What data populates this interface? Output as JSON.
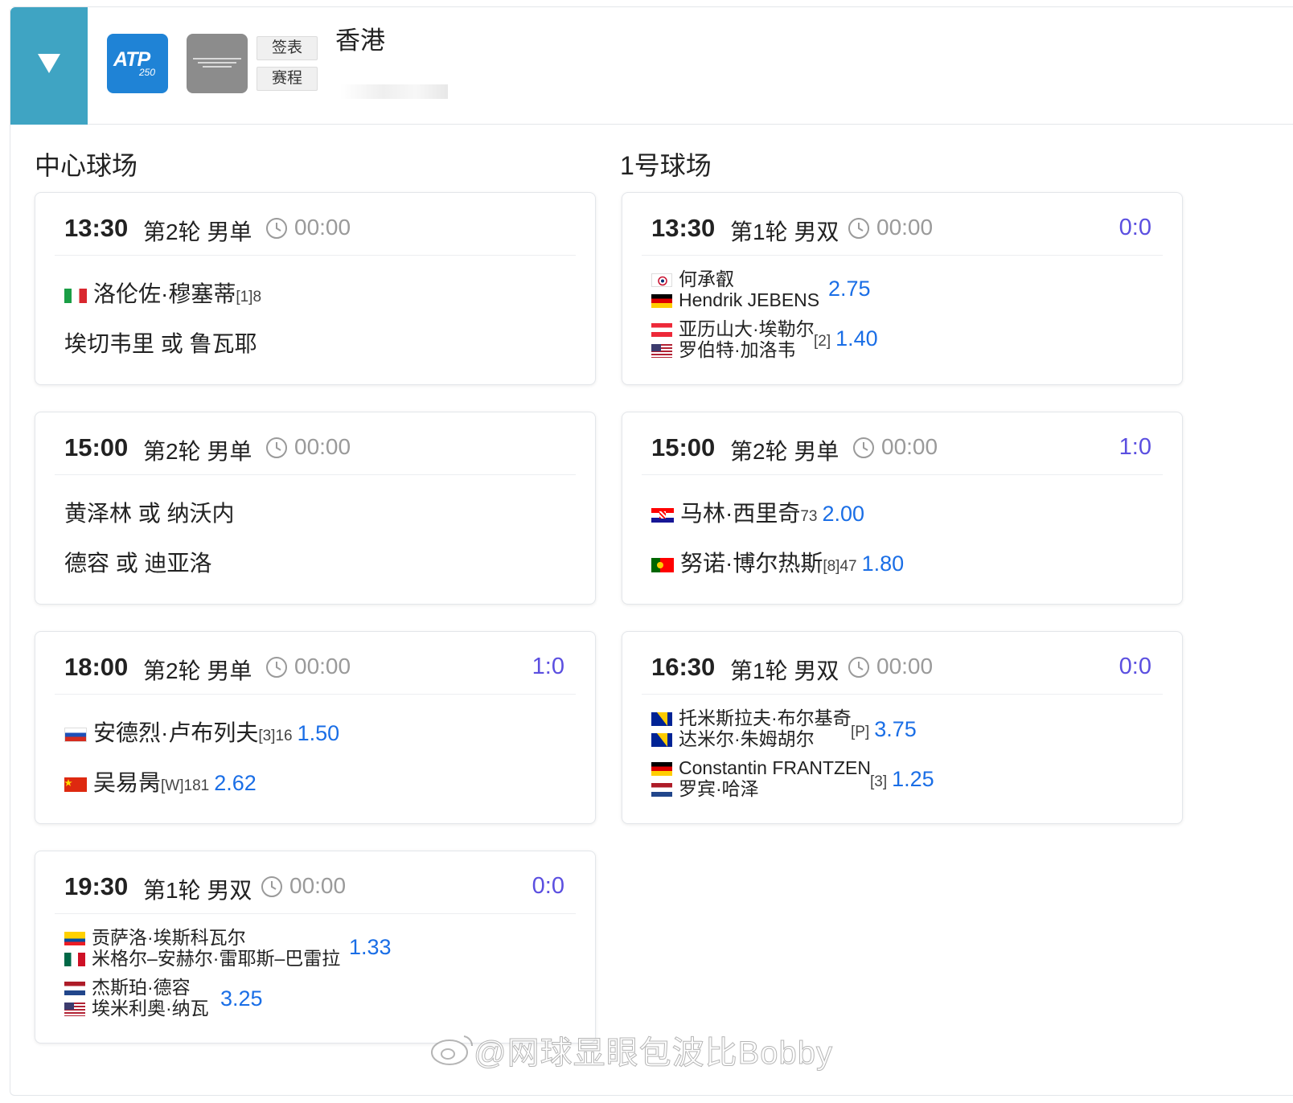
{
  "header": {
    "toggle_icon": "triangle-down-icon",
    "atp_logo_text": "ATP",
    "atp_logo_num": "250",
    "tab_draw": "签表",
    "tab_schedule": "赛程",
    "city": "香港"
  },
  "colors": {
    "toggle_bg": "#3fa4c3",
    "atp_blue": "#1f83d6",
    "odds_blue": "#1a6ee6",
    "score_purple": "#5b4fe0"
  },
  "courts": [
    {
      "name": "中心球场",
      "matches": [
        {
          "time": "13:30",
          "round": "第2轮 男单",
          "elapsed": "00:00",
          "score": "",
          "row1": {
            "name": "洛伦佐·穆塞蒂",
            "seed": "[1]8",
            "odds": ""
          },
          "row2": {
            "name": "埃切韦里  或  鲁瓦耶"
          }
        },
        {
          "time": "15:00",
          "round": "第2轮 男单",
          "elapsed": "00:00",
          "score": "",
          "row1": {
            "name": "黄泽林  或  纳沃内"
          },
          "row2": {
            "name": "德容  或  迪亚洛"
          }
        },
        {
          "time": "18:00",
          "round": "第2轮 男单",
          "elapsed": "00:00",
          "score": "1:0",
          "row1": {
            "name": "安德烈·卢布列夫",
            "seed": "[3]16",
            "odds": "1.50"
          },
          "row2": {
            "name": "吴易昺",
            "seed": "[W]181",
            "odds": "2.62"
          }
        },
        {
          "time": "19:30",
          "round": "第1轮 男双",
          "elapsed": "00:00",
          "score": "0:0",
          "team1": {
            "p1": "贡萨洛·埃斯科瓦尔",
            "p2": "米格尔–安赫尔·雷耶斯–巴雷拉",
            "seed": "",
            "odds": "1.33"
          },
          "team2": {
            "p1": "杰斯珀·德容",
            "p2": "埃米利奥·纳瓦",
            "seed": "",
            "odds": "3.25"
          }
        }
      ]
    },
    {
      "name": "1号球场",
      "matches": [
        {
          "time": "13:30",
          "round": "第1轮 男双",
          "elapsed": "00:00",
          "score": "0:0",
          "team1": {
            "p1": "何承叡",
            "p2": "Hendrik JEBENS",
            "seed": "",
            "odds": "2.75"
          },
          "team2": {
            "p1": "亚历山大·埃勒尔",
            "p2": "罗伯特·加洛韦",
            "seed": "[2]",
            "odds": "1.40"
          }
        },
        {
          "time": "15:00",
          "round": "第2轮 男单",
          "elapsed": "00:00",
          "score": "1:0",
          "row1": {
            "name": "马林·西里奇",
            "seed": "73",
            "odds": "2.00"
          },
          "row2": {
            "name": "努诺·博尔热斯",
            "seed": "[8]47",
            "odds": "1.80"
          }
        },
        {
          "time": "16:30",
          "round": "第1轮 男双",
          "elapsed": "00:00",
          "score": "0:0",
          "team1": {
            "p1": "托米斯拉夫·布尔基奇",
            "p2": "达米尔·朱姆胡尔",
            "seed": "[P]",
            "odds": "3.75"
          },
          "team2": {
            "p1": "Constantin FRANTZEN",
            "p2": "罗宾·哈泽",
            "seed": "[3]",
            "odds": "1.25"
          }
        }
      ]
    }
  ],
  "watermark": "@网球显眼包波比Bobby"
}
